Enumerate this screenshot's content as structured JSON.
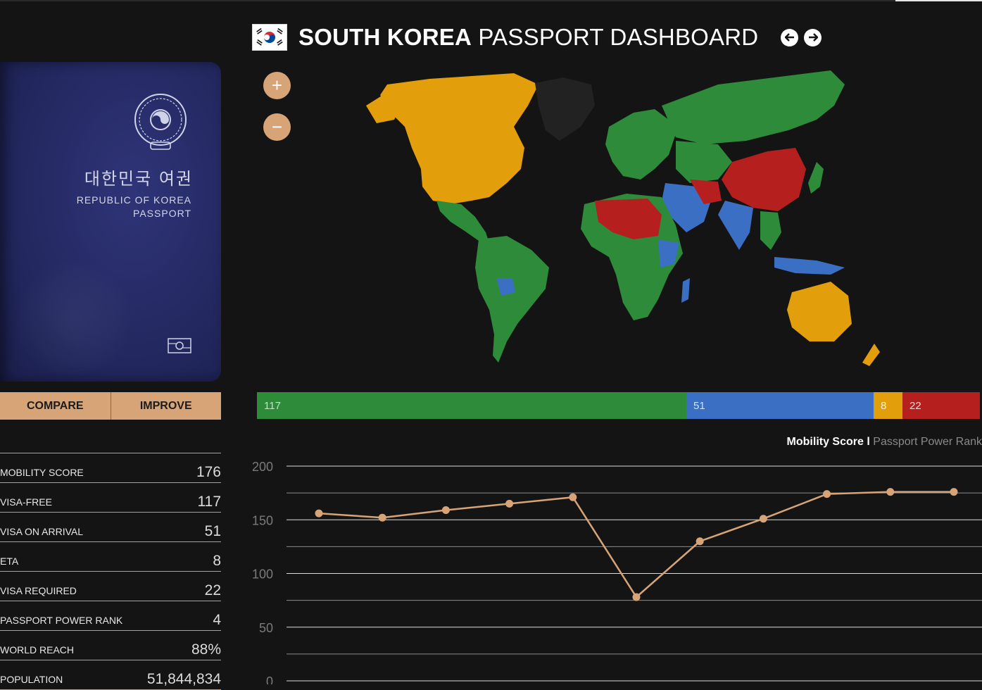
{
  "header": {
    "title_bold": "SOUTH KOREA",
    "title_rest": "PASSPORT DASHBOARD"
  },
  "passport": {
    "korean_title": "대한민국 여권",
    "english_line1": "REPUBLIC OF KOREA",
    "english_line2": "PASSPORT"
  },
  "actions": {
    "compare": "COMPARE",
    "improve": "IMPROVE"
  },
  "zoom": {
    "in": "+",
    "out": "−"
  },
  "stats": [
    {
      "label": "MOBILITY SCORE",
      "value": "176"
    },
    {
      "label": "VISA-FREE",
      "value": "117"
    },
    {
      "label": "VISA ON ARRIVAL",
      "value": "51"
    },
    {
      "label": "ETA",
      "value": "8"
    },
    {
      "label": "VISA REQUIRED",
      "value": "22"
    },
    {
      "label": "PASSPORT POWER RANK",
      "value": "4"
    },
    {
      "label": "WORLD REACH",
      "value": "88%"
    },
    {
      "label": "POPULATION",
      "value": "51,844,834"
    }
  ],
  "distribution": {
    "visa_free": "117",
    "visa_on_arrival": "51",
    "eta": "8",
    "visa_required": "22"
  },
  "colors": {
    "visa_free": "#2e8b3a",
    "visa_on_arrival": "#3a6fc4",
    "eta": "#e39e0b",
    "visa_required": "#b5201e",
    "accent": "#d7a478",
    "background": "#151414"
  },
  "legend": {
    "active": "Mobility Score",
    "separator": "l",
    "inactive": "Passport Power Rank"
  },
  "chart_data": {
    "type": "line",
    "series": [
      {
        "name": "Mobility Score",
        "values": [
          156,
          152,
          159,
          165,
          171,
          78,
          130,
          151,
          174,
          176,
          176
        ]
      }
    ],
    "ylim": [
      0,
      200
    ],
    "yticks": [
      0,
      50,
      100,
      150,
      200
    ],
    "grid": true,
    "color": "#d7a478"
  }
}
